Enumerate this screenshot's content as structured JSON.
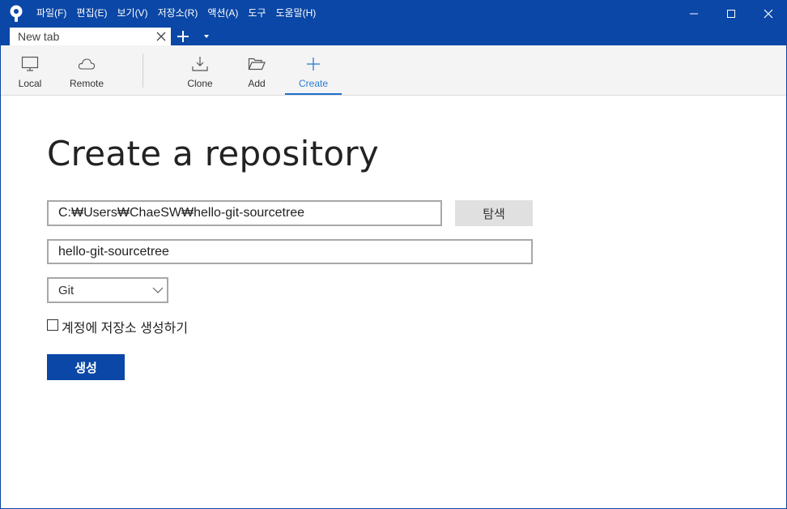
{
  "menu": [
    "파일(F)",
    "편집(E)",
    "보기(V)",
    "저장소(R)",
    "액션(A)",
    "도구",
    "도움말(H)"
  ],
  "tab": {
    "label": "New tab"
  },
  "toolbar": {
    "local": "Local",
    "remote": "Remote",
    "clone": "Clone",
    "add": "Add",
    "create": "Create"
  },
  "form": {
    "title": "Create a repository",
    "path_value": "C:₩Users₩ChaeSW₩hello-git-sourcetree",
    "browse_label": "탐색",
    "name_value": "hello-git-sourcetree",
    "vcs_selected": "Git",
    "checkbox_label": "계정에 저장소 생성하기",
    "checkbox_checked": false,
    "create_label": "생성"
  },
  "colors": {
    "titlebar": "#0a47a6",
    "accent": "#2a7bd4",
    "primary_button": "#0a47a6"
  },
  "icons": [
    "sourcetree-logo-icon",
    "minimize-icon",
    "maximize-icon",
    "close-icon",
    "tab-close-icon",
    "plus-icon",
    "chevron-down-icon",
    "monitor-icon",
    "cloud-icon",
    "download-icon",
    "folder-open-icon"
  ]
}
